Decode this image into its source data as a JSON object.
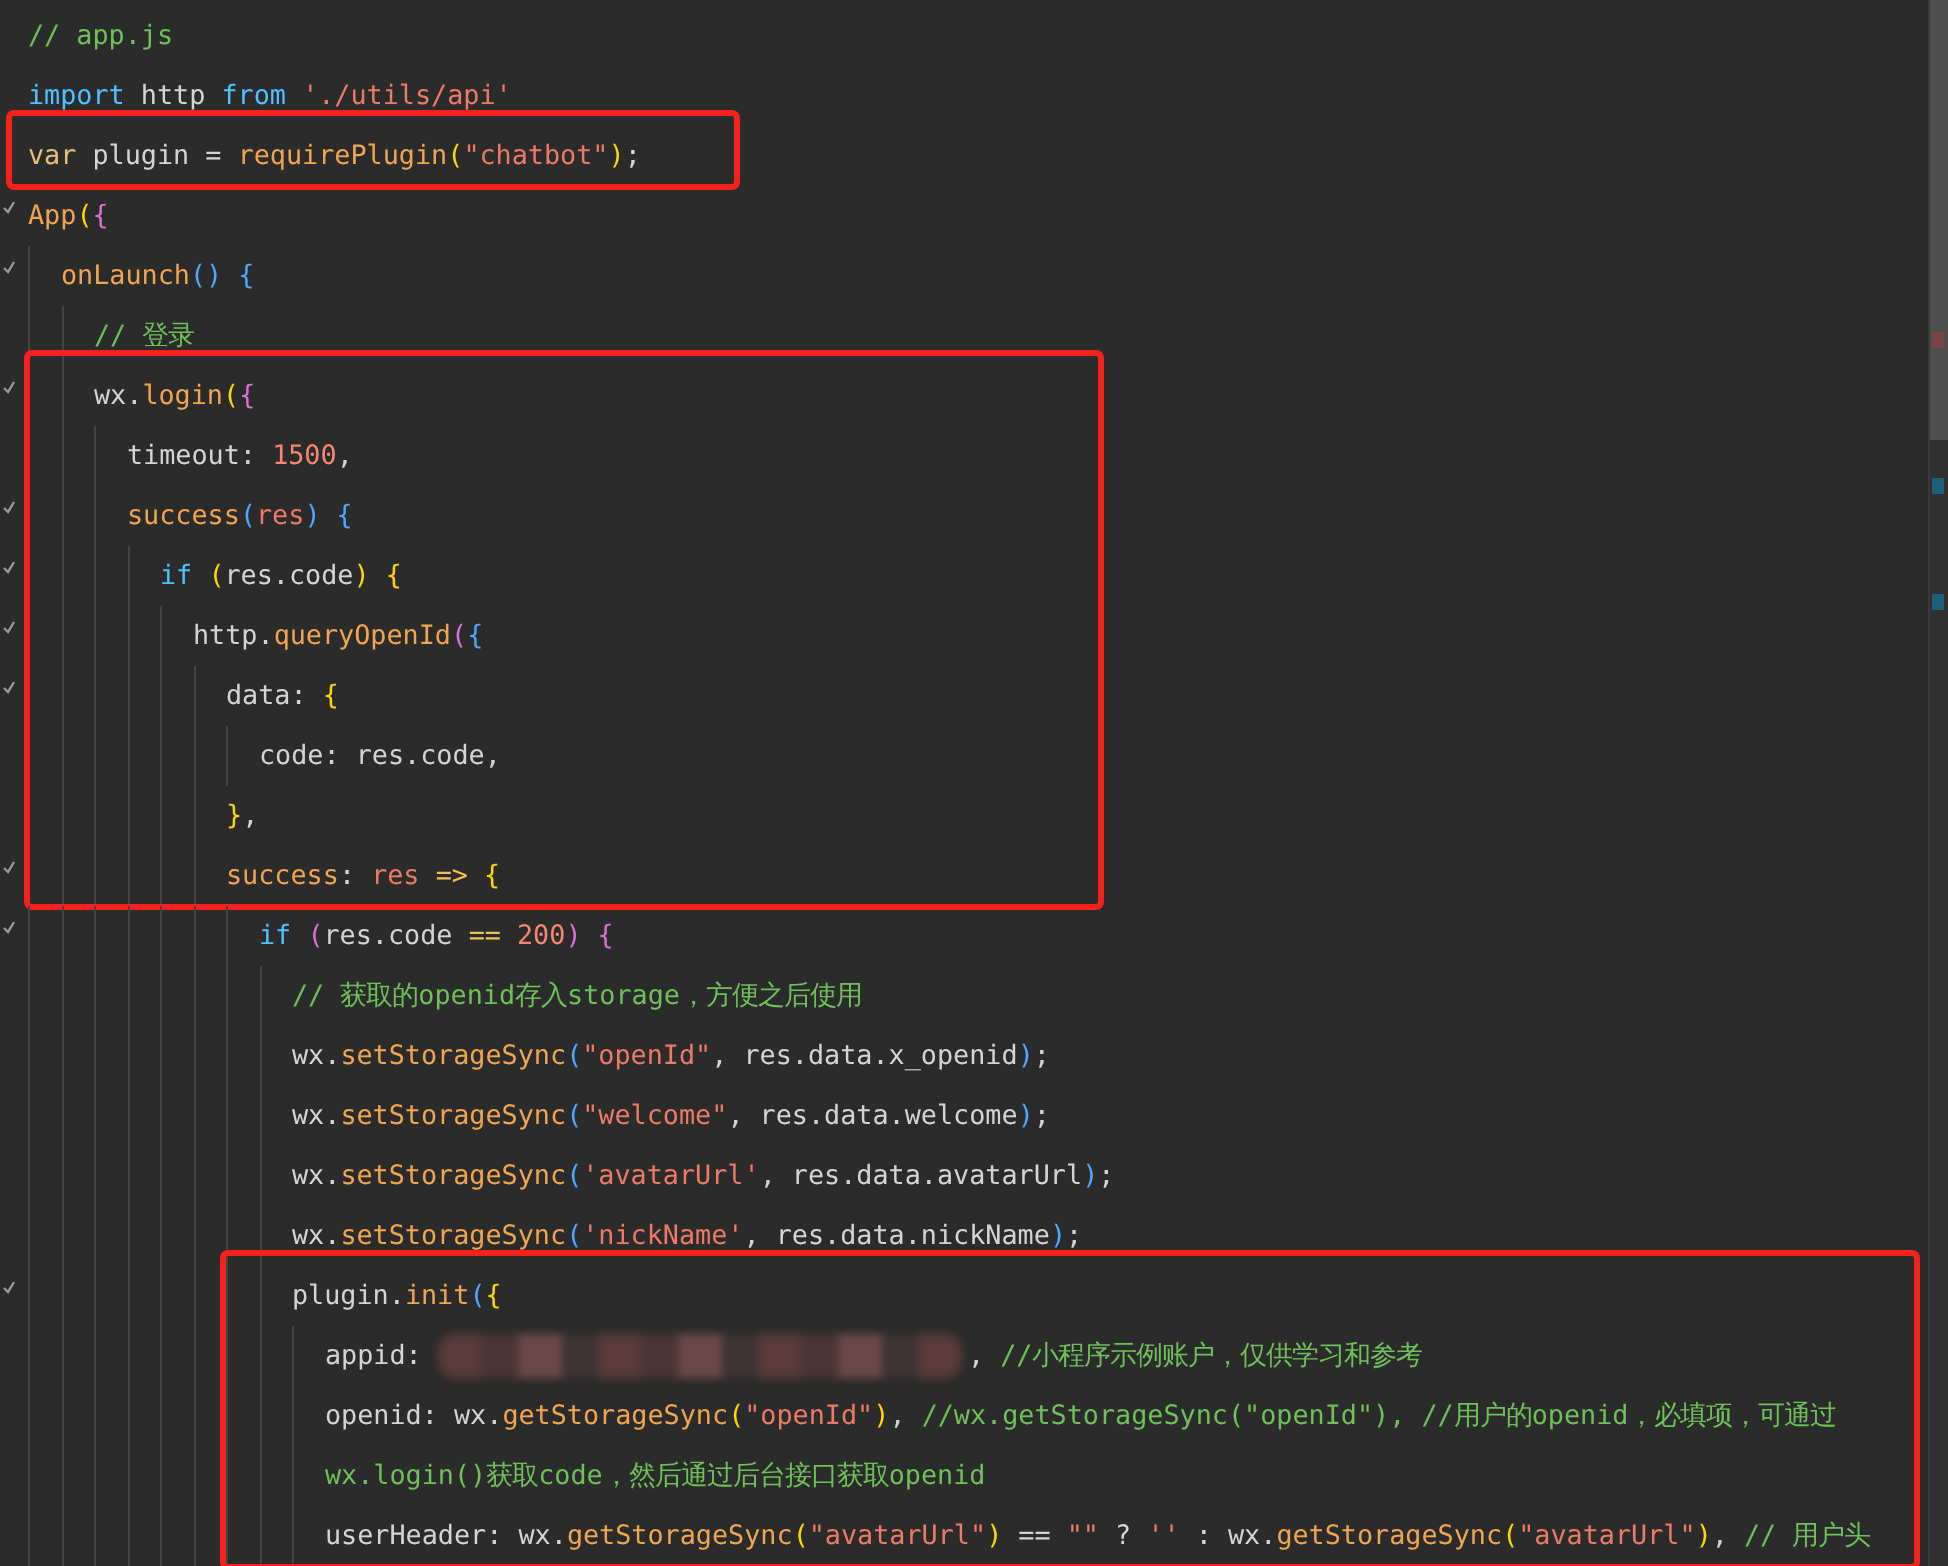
{
  "editor": {
    "lines": [
      {
        "boxed": false,
        "tokens": [
          {
            "kind": "comment",
            "text": "// app.js"
          }
        ]
      },
      {
        "boxed": false,
        "tokens": [
          {
            "kind": "keyword",
            "text": "import"
          },
          {
            "kind": "plain",
            "text": " http "
          },
          {
            "kind": "keyword",
            "text": "from "
          },
          {
            "kind": "string",
            "text": "'./utils/api'"
          }
        ]
      },
      {
        "boxed": true,
        "tokens": [
          {
            "kind": "storage",
            "text": "var"
          },
          {
            "kind": "plain",
            "text": " plugin = "
          },
          {
            "kind": "func",
            "text": "requirePlugin"
          },
          {
            "kind": "bracket1",
            "text": "("
          },
          {
            "kind": "string",
            "text": "\"chatbot\""
          },
          {
            "kind": "bracket1",
            "text": ")"
          },
          {
            "kind": "plain",
            "text": ";"
          }
        ]
      },
      {
        "boxed": false,
        "tokens": [
          {
            "kind": "func",
            "text": "App"
          },
          {
            "kind": "bracket1",
            "text": "("
          },
          {
            "kind": "bracket2",
            "text": "{"
          }
        ],
        "children": [
          {
            "boxed": false,
            "tokens": [
              {
                "kind": "func",
                "text": "onLaunch"
              },
              {
                "kind": "bracket3",
                "text": "() {"
              }
            ],
            "children": [
              {
                "boxed": false,
                "tokens": [
                  {
                    "kind": "comment",
                    "text": "// 登录"
                  }
                ]
              },
              {
                "boxed": true,
                "tokens": [
                  {
                    "kind": "plain",
                    "text": "wx."
                  },
                  {
                    "kind": "func",
                    "text": "login"
                  },
                  {
                    "kind": "bracket1",
                    "text": "("
                  },
                  {
                    "kind": "bracket2",
                    "text": "{"
                  }
                ],
                "children": [
                  {
                    "boxed": true,
                    "tokens": [
                      {
                        "kind": "plain",
                        "text": "timeout: "
                      },
                      {
                        "kind": "number",
                        "text": "1500"
                      },
                      {
                        "kind": "plain",
                        "text": ","
                      }
                    ]
                  },
                  {
                    "boxed": true,
                    "tokens": [
                      {
                        "kind": "func",
                        "text": "success"
                      },
                      {
                        "kind": "bracket3",
                        "text": "("
                      },
                      {
                        "kind": "param",
                        "text": "res"
                      },
                      {
                        "kind": "bracket3",
                        "text": ") {"
                      }
                    ],
                    "children": [
                      {
                        "boxed": true,
                        "tokens": [
                          {
                            "kind": "keyword",
                            "text": "if "
                          },
                          {
                            "kind": "bracket1",
                            "text": "("
                          },
                          {
                            "kind": "plain",
                            "text": "res.code"
                          },
                          {
                            "kind": "bracket1",
                            "text": ") {"
                          }
                        ],
                        "children": [
                          {
                            "boxed": true,
                            "tokens": [
                              {
                                "kind": "plain",
                                "text": "http."
                              },
                              {
                                "kind": "func",
                                "text": "queryOpenId"
                              },
                              {
                                "kind": "bracket2",
                                "text": "("
                              },
                              {
                                "kind": "bracket3",
                                "text": "{"
                              }
                            ],
                            "children": [
                              {
                                "boxed": true,
                                "tokens": [
                                  {
                                    "kind": "plain",
                                    "text": "data: "
                                  },
                                  {
                                    "kind": "bracket1",
                                    "text": "{"
                                  }
                                ],
                                "children": [
                                  {
                                    "boxed": true,
                                    "tokens": [
                                      {
                                        "kind": "plain",
                                        "text": "code: res.code,"
                                      }
                                    ]
                                  }
                                ]
                              },
                              {
                                "boxed": true,
                                "tokens": [
                                  {
                                    "kind": "bracket1",
                                    "text": "}"
                                  },
                                  {
                                    "kind": "plain",
                                    "text": ","
                                  }
                                ]
                              },
                              {
                                "boxed": true,
                                "tokens": [
                                  {
                                    "kind": "func",
                                    "text": "success"
                                  },
                                  {
                                    "kind": "plain",
                                    "text": ": "
                                  },
                                  {
                                    "kind": "param",
                                    "text": "res "
                                  },
                                  {
                                    "kind": "operator",
                                    "text": "=> "
                                  },
                                  {
                                    "kind": "bracket1",
                                    "text": "{"
                                  }
                                ],
                                "children": [
                                  {
                                    "boxed": false,
                                    "tokens": [
                                      {
                                        "kind": "keyword",
                                        "text": "if "
                                      },
                                      {
                                        "kind": "bracket2",
                                        "text": "("
                                      },
                                      {
                                        "kind": "plain",
                                        "text": "res.code "
                                      },
                                      {
                                        "kind": "operator",
                                        "text": "== "
                                      },
                                      {
                                        "kind": "number",
                                        "text": "200"
                                      },
                                      {
                                        "kind": "bracket2",
                                        "text": ") {"
                                      }
                                    ],
                                    "children": [
                                      {
                                        "boxed": false,
                                        "tokens": [
                                          {
                                            "kind": "comment",
                                            "text": "// 获取的openid存入storage，方便之后使用"
                                          }
                                        ]
                                      },
                                      {
                                        "boxed": false,
                                        "tokens": [
                                          {
                                            "kind": "plain",
                                            "text": "wx."
                                          },
                                          {
                                            "kind": "func",
                                            "text": "setStorageSync"
                                          },
                                          {
                                            "kind": "bracket3",
                                            "text": "("
                                          },
                                          {
                                            "kind": "string",
                                            "text": "\"openId\""
                                          },
                                          {
                                            "kind": "plain",
                                            "text": ", res.data.x_openid"
                                          },
                                          {
                                            "kind": "bracket3",
                                            "text": ")"
                                          },
                                          {
                                            "kind": "plain",
                                            "text": ";"
                                          }
                                        ]
                                      },
                                      {
                                        "boxed": false,
                                        "tokens": [
                                          {
                                            "kind": "plain",
                                            "text": "wx."
                                          },
                                          {
                                            "kind": "func",
                                            "text": "setStorageSync"
                                          },
                                          {
                                            "kind": "bracket3",
                                            "text": "("
                                          },
                                          {
                                            "kind": "string",
                                            "text": "\"welcome\""
                                          },
                                          {
                                            "kind": "plain",
                                            "text": ", res.data.welcome"
                                          },
                                          {
                                            "kind": "bracket3",
                                            "text": ")"
                                          },
                                          {
                                            "kind": "plain",
                                            "text": ";"
                                          }
                                        ]
                                      },
                                      {
                                        "boxed": false,
                                        "tokens": [
                                          {
                                            "kind": "plain",
                                            "text": "wx."
                                          },
                                          {
                                            "kind": "func",
                                            "text": "setStorageSync"
                                          },
                                          {
                                            "kind": "bracket3",
                                            "text": "("
                                          },
                                          {
                                            "kind": "string",
                                            "text": "'avatarUrl'"
                                          },
                                          {
                                            "kind": "plain",
                                            "text": ", res.data.avatarUrl"
                                          },
                                          {
                                            "kind": "bracket3",
                                            "text": ")"
                                          },
                                          {
                                            "kind": "plain",
                                            "text": ";"
                                          }
                                        ]
                                      },
                                      {
                                        "boxed": false,
                                        "tokens": [
                                          {
                                            "kind": "plain",
                                            "text": "wx."
                                          },
                                          {
                                            "kind": "func",
                                            "text": "setStorageSync"
                                          },
                                          {
                                            "kind": "bracket3",
                                            "text": "("
                                          },
                                          {
                                            "kind": "string",
                                            "text": "'nickName'"
                                          },
                                          {
                                            "kind": "plain",
                                            "text": ", res.data.nickName"
                                          },
                                          {
                                            "kind": "bracket3",
                                            "text": ")"
                                          },
                                          {
                                            "kind": "plain",
                                            "text": ";"
                                          }
                                        ]
                                      },
                                      {
                                        "boxed": true,
                                        "tokens": [
                                          {
                                            "kind": "plain",
                                            "text": "plugin."
                                          },
                                          {
                                            "kind": "func",
                                            "text": "init"
                                          },
                                          {
                                            "kind": "bracket3",
                                            "text": "("
                                          },
                                          {
                                            "kind": "bracket1",
                                            "text": "{"
                                          }
                                        ],
                                        "children": [
                                          {
                                            "boxed": true,
                                            "tokens": [
                                              {
                                                "kind": "plain",
                                                "text": "appid: "
                                              },
                                              {
                                                "kind": "redacted"
                                              },
                                              {
                                                "kind": "plain",
                                                "text": ", "
                                              },
                                              {
                                                "kind": "comment",
                                                "text": "//小程序示例账户，仅供学习和参考"
                                              }
                                            ]
                                          },
                                          {
                                            "boxed": true,
                                            "tokens": [
                                              {
                                                "kind": "plain",
                                                "text": "openid: wx."
                                              },
                                              {
                                                "kind": "func",
                                                "text": "getStorageSync"
                                              },
                                              {
                                                "kind": "bracket1",
                                                "text": "("
                                              },
                                              {
                                                "kind": "string",
                                                "text": "\"openId\""
                                              },
                                              {
                                                "kind": "bracket1",
                                                "text": ")"
                                              },
                                              {
                                                "kind": "plain",
                                                "text": ", "
                                              },
                                              {
                                                "kind": "comment",
                                                "text": "//wx.getStorageSync(\"openId\"), //用户的openid，必填项，可通过"
                                              }
                                            ]
                                          },
                                          {
                                            "boxed": true,
                                            "tokens": [
                                              {
                                                "kind": "comment",
                                                "text": "wx.login()获取code，然后通过后台接口获取openid"
                                              }
                                            ]
                                          },
                                          {
                                            "boxed": true,
                                            "tokens": [
                                              {
                                                "kind": "plain",
                                                "text": "userHeader: wx."
                                              },
                                              {
                                                "kind": "func",
                                                "text": "getStorageSync"
                                              },
                                              {
                                                "kind": "bracket1",
                                                "text": "("
                                              },
                                              {
                                                "kind": "string",
                                                "text": "\"avatarUrl\""
                                              },
                                              {
                                                "kind": "bracket1",
                                                "text": ")"
                                              },
                                              {
                                                "kind": "plain",
                                                "text": " == "
                                              },
                                              {
                                                "kind": "string",
                                                "text": "\"\""
                                              },
                                              {
                                                "kind": "plain",
                                                "text": " ? "
                                              },
                                              {
                                                "kind": "string",
                                                "text": "''"
                                              },
                                              {
                                                "kind": "plain",
                                                "text": " : wx."
                                              },
                                              {
                                                "kind": "func",
                                                "text": "getStorageSync"
                                              },
                                              {
                                                "kind": "bracket1",
                                                "text": "("
                                              },
                                              {
                                                "kind": "string",
                                                "text": "\"avatarUrl\""
                                              },
                                              {
                                                "kind": "bracket1",
                                                "text": ")"
                                              },
                                              {
                                                "kind": "plain",
                                                "text": ", "
                                              },
                                              {
                                                "kind": "comment",
                                                "text": "// 用户头"
                                              }
                                            ]
                                          }
                                        ]
                                      }
                                    ]
                                  }
                                ]
                              }
                            ]
                          }
                        ]
                      }
                    ]
                  }
                ]
              }
            ]
          }
        ]
      }
    ]
  }
}
